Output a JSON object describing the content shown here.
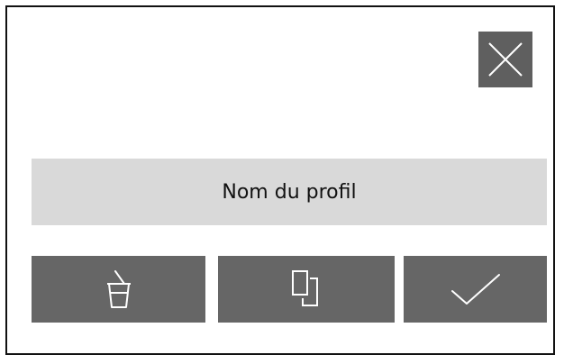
{
  "dialog": {
    "close_icon": "close-icon",
    "profile_name_label": "Nom du profil"
  },
  "actions": [
    {
      "icon": "delete-cup-icon"
    },
    {
      "icon": "copy-icon"
    },
    {
      "icon": "check-icon"
    }
  ],
  "colors": {
    "button_bg": "#666666",
    "field_bg": "#d9d9d9",
    "frame_border": "#111111",
    "icon_stroke": "#ffffff"
  }
}
